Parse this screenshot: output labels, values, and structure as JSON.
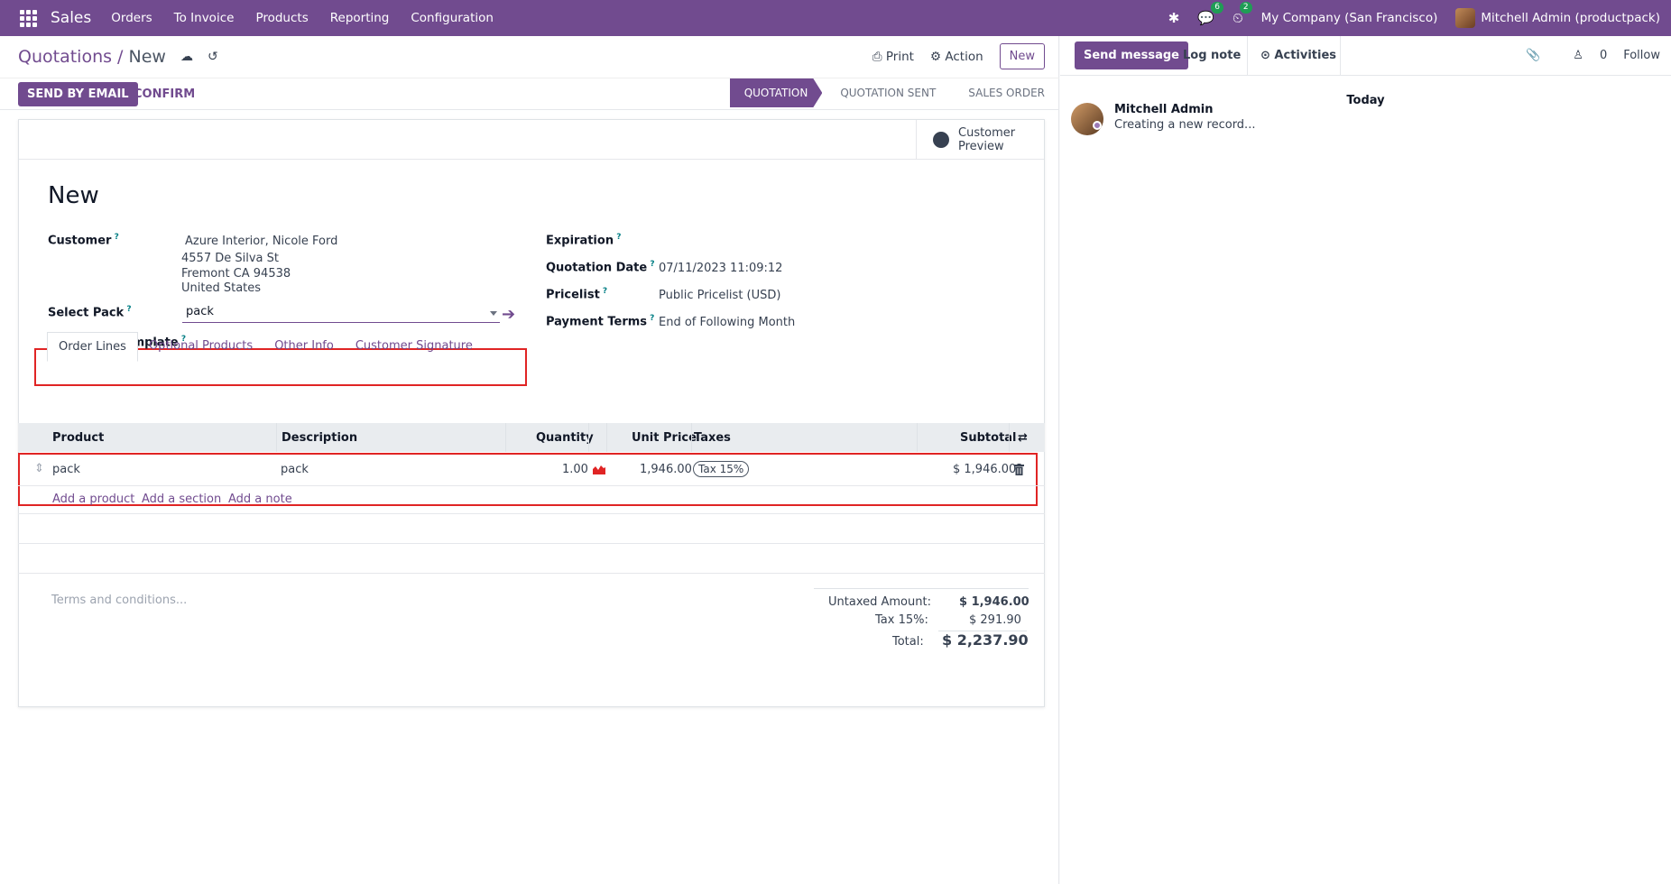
{
  "topbar": {
    "app_name": "Sales",
    "menu": [
      "Orders",
      "To Invoice",
      "Products",
      "Reporting",
      "Configuration"
    ],
    "messages_badge": "6",
    "activities_badge": "2",
    "company": "My Company (San Francisco)",
    "user": "Mitchell Admin (productpack)"
  },
  "control_panel": {
    "breadcrumb_parent": "Quotations",
    "breadcrumb_sep": " / ",
    "breadcrumb_current": "New",
    "print_label": "Print",
    "action_label": "Action",
    "new_label": "New",
    "send_email_label": "SEND BY EMAIL",
    "confirm_label": "CONFIRM",
    "stages": [
      "QUOTATION",
      "QUOTATION SENT",
      "SALES ORDER"
    ],
    "active_stage": "QUOTATION"
  },
  "form": {
    "customer_preview": [
      "Customer",
      "Preview"
    ],
    "title": "New",
    "customer_label": "Customer",
    "customer_name": "Azure Interior, Nicole Ford",
    "customer_address": [
      "4557 De Silva St",
      "Fremont CA 94538",
      "United States"
    ],
    "select_pack_label": "Select Pack",
    "select_pack_value": "pack",
    "quotation_template_label": "Quotation Template",
    "expiration_label": "Expiration",
    "quotation_date_label": "Quotation Date",
    "quotation_date_value": "07/11/2023 11:09:12",
    "pricelist_label": "Pricelist",
    "pricelist_value": "Public Pricelist (USD)",
    "payment_terms_label": "Payment Terms",
    "payment_terms_value": "End of Following Month"
  },
  "tabs": [
    "Order Lines",
    "Optional Products",
    "Other Info",
    "Customer Signature"
  ],
  "order_lines": {
    "columns": [
      "Product",
      "Description",
      "Quantity",
      "Unit Price",
      "Taxes",
      "Subtotal"
    ],
    "rows": [
      {
        "product": "pack",
        "description": "pack",
        "quantity": "1.00",
        "unit_price": "1,946.00",
        "tax": "Tax 15%",
        "subtotal": "$ 1,946.00"
      }
    ],
    "add_product": "Add a product",
    "add_section": "Add a section",
    "add_note": "Add a note"
  },
  "footer": {
    "terms_placeholder": "Terms and conditions...",
    "untaxed_label": "Untaxed Amount:",
    "untaxed_value": "$ 1,946.00",
    "tax_label": "Tax 15%:",
    "tax_value": "$ 291.90",
    "total_label": "Total:",
    "total_value": "$ 2,237.90"
  },
  "chatter": {
    "send_message": "Send message",
    "log_note": "Log note",
    "activities": "Activities",
    "followers_count": "0",
    "follow": "Follow",
    "today": "Today",
    "message_author": "Mitchell Admin",
    "message_body": "Creating a new record..."
  },
  "colors": {
    "brand": "#714b8f",
    "highlight": "#e02424"
  }
}
